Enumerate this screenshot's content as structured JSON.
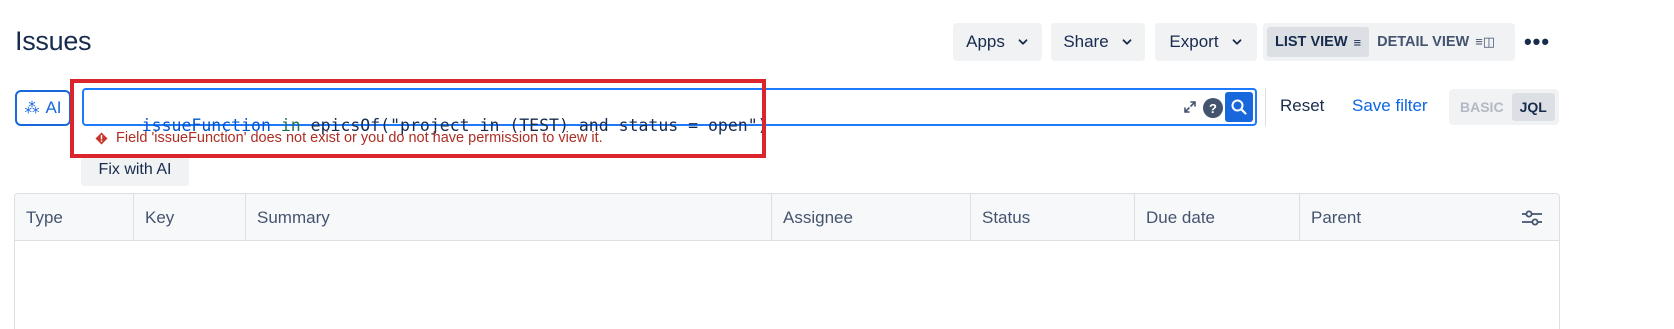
{
  "page": {
    "title": "Issues"
  },
  "toolbar": {
    "apps_label": "Apps",
    "share_label": "Share",
    "export_label": "Export",
    "list_view_label": "LIST VIEW",
    "list_view_icon": "≡",
    "detail_view_label": "DETAIL VIEW",
    "detail_view_icon": "≡◫",
    "more_label": "•••"
  },
  "search": {
    "ai_label": "AI",
    "ai_icon": "⁂",
    "jql_tokens": [
      {
        "text": "issueFunction",
        "kind": "field"
      },
      {
        "text": " ",
        "kind": "plain"
      },
      {
        "text": "in",
        "kind": "operator"
      },
      {
        "text": " epicsOf(\"project in (TEST) and status = open\")",
        "kind": "plain"
      }
    ],
    "help_label": "?",
    "reset_label": "Reset",
    "save_filter_label": "Save filter",
    "mode_basic": "BASIC",
    "mode_jql": "JQL",
    "active_mode": "JQL",
    "error_message": "Field 'issueFunction' does not exist or you do not have permission to view it.",
    "fix_with_ai_label": "Fix with AI"
  },
  "table": {
    "columns": [
      "Type",
      "Key",
      "Summary",
      "Assignee",
      "Status",
      "Due date",
      "Parent"
    ],
    "rows": []
  },
  "colors": {
    "accent": "#1868db",
    "error": "#ae2e24",
    "annotation_box": "#d9252b"
  }
}
